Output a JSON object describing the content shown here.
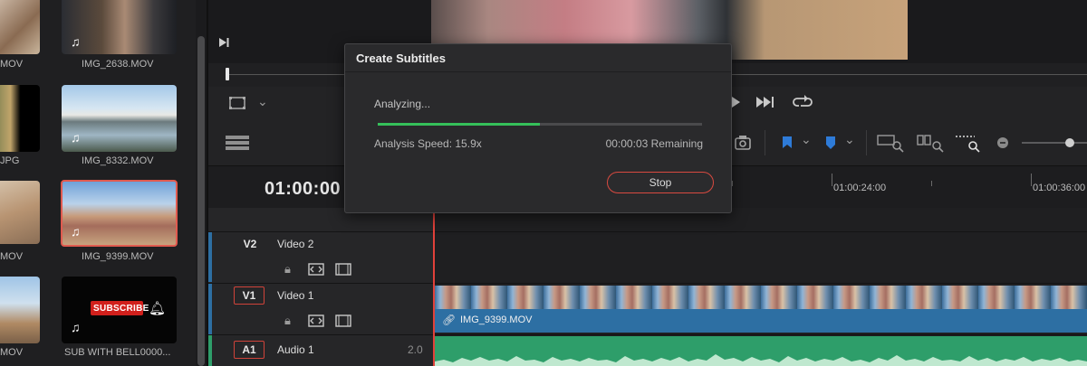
{
  "media_pool": {
    "clips": [
      {
        "name": "MOV",
        "row": 0,
        "col": 0
      },
      {
        "name": "IMG_2638.MOV",
        "row": 0,
        "col": 1
      },
      {
        "name": "JPG",
        "row": 1,
        "col": 0
      },
      {
        "name": "IMG_8332.MOV",
        "row": 1,
        "col": 1
      },
      {
        "name": "MOV",
        "row": 2,
        "col": 0
      },
      {
        "name": "IMG_9399.MOV",
        "row": 2,
        "col": 1
      },
      {
        "name": "MOV",
        "row": 3,
        "col": 0
      },
      {
        "name": "SUB WITH BELL0000...",
        "row": 3,
        "col": 1
      }
    ],
    "subscribe_text": "SUBSCRIBE"
  },
  "timeline": {
    "timecode": "01:00:00",
    "ruler_labels": [
      "01:00:24:00",
      "01:00:36:00"
    ],
    "tracks": [
      {
        "id": "V2",
        "name": "Video 2",
        "value": ""
      },
      {
        "id": "V1",
        "name": "Video 1",
        "value": ""
      },
      {
        "id": "A1",
        "name": "Audio 1",
        "value": "2.0"
      }
    ],
    "clip_label": "IMG_9399.MOV"
  },
  "dialog": {
    "title": "Create Subtitles",
    "status": "Analyzing...",
    "progress": 0.5,
    "speed": "Analysis Speed: 15.9x",
    "remaining": "00:00:03 Remaining",
    "stop_label": "Stop"
  },
  "colors": {
    "accent_red": "#d94a40",
    "progress_green": "#35c05a",
    "video_clip_blue": "#2d6fa3",
    "audio_clip_green": "#2e9e6a"
  }
}
